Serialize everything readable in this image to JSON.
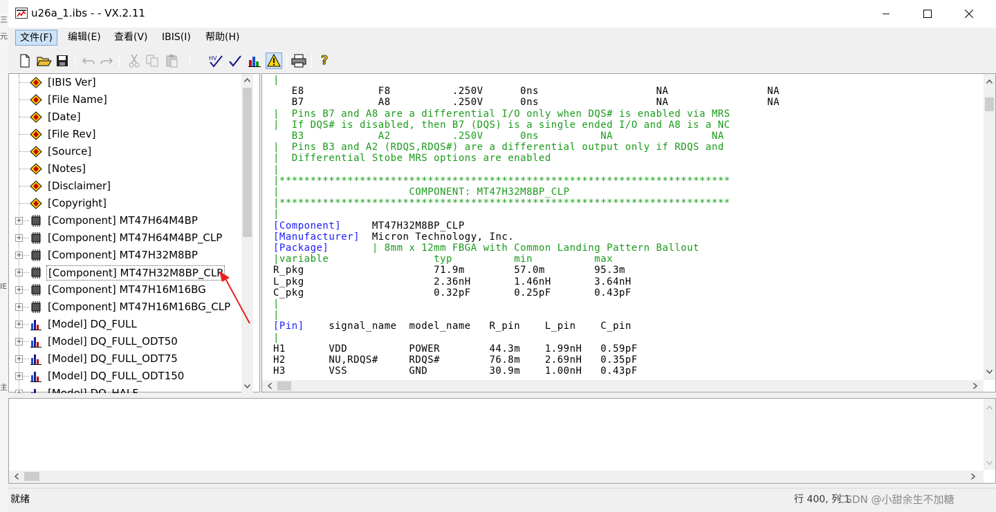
{
  "window": {
    "title": "u26a_1.ibs - - VX.2.11"
  },
  "menu": {
    "file": "文件(F)",
    "edit": "编辑(E)",
    "view": "查看(V)",
    "ibis": "IBIS(I)",
    "help": "帮助(H)"
  },
  "toolbar": {
    "icons": [
      "new-file-icon",
      "open-folder-icon",
      "save-icon",
      "undo-icon",
      "redo-icon",
      "cut-icon",
      "copy-icon",
      "paste-icon",
      "check-syntax-icon",
      "check-icon",
      "chart-icon",
      "warning-icon",
      "print-icon",
      "help-icon"
    ]
  },
  "tree": {
    "items": [
      {
        "label": "[IBIS Ver]",
        "type": "keyword"
      },
      {
        "label": "[File Name]",
        "type": "keyword"
      },
      {
        "label": "[Date]",
        "type": "keyword"
      },
      {
        "label": "[File Rev]",
        "type": "keyword"
      },
      {
        "label": "[Source]",
        "type": "keyword"
      },
      {
        "label": "[Notes]",
        "type": "keyword"
      },
      {
        "label": "[Disclaimer]",
        "type": "keyword"
      },
      {
        "label": "[Copyright]",
        "type": "keyword"
      },
      {
        "label": "[Component] MT47H64M4BP",
        "type": "component"
      },
      {
        "label": "[Component] MT47H64M4BP_CLP",
        "type": "component"
      },
      {
        "label": "[Component] MT47H32M8BP",
        "type": "component"
      },
      {
        "label": "[Component] MT47H32M8BP_CLP",
        "type": "component",
        "selected": true
      },
      {
        "label": "[Component] MT47H16M16BG",
        "type": "component"
      },
      {
        "label": "[Component] MT47H16M16BG_CLP",
        "type": "component"
      },
      {
        "label": "[Model] DQ_FULL",
        "type": "model"
      },
      {
        "label": "[Model] DQ_FULL_ODT50",
        "type": "model"
      },
      {
        "label": "[Model] DQ_FULL_ODT75",
        "type": "model"
      },
      {
        "label": "[Model] DQ_FULL_ODT150",
        "type": "model"
      },
      {
        "label": "[Model] DQ_HALF",
        "type": "model"
      }
    ]
  },
  "code": {
    "lines": [
      {
        "text": "|",
        "color": "green"
      },
      {
        "text": "   E8            F8          .250V      0ns                   NA                NA",
        "color": "black"
      },
      {
        "text": "   B7            A8          .250V      0ns                   NA                NA",
        "color": "black"
      },
      {
        "text": "|  Pins B7 and A8 are a differential I/O only when DQS# is enabled via MRS",
        "color": "green"
      },
      {
        "text": "|  If DQS# is disabled, then B7 (DQS) is a single ended I/O and A8 is a NC",
        "color": "green"
      },
      {
        "text": "   B3            A2          .250V      0ns          NA                NA",
        "color": "green"
      },
      {
        "text": "|  Pins B3 and A2 (RDQS,RDQS#) are a differential output only if RDQS and",
        "color": "green"
      },
      {
        "text": "|  Differential Stobe MRS options are enabled",
        "color": "green"
      },
      {
        "text": "|",
        "color": "green"
      },
      {
        "text": "|*************************************************************************",
        "color": "green"
      },
      {
        "text": "|                     COMPONENT: MT47H32M8BP_CLP",
        "color": "green"
      },
      {
        "text": "|*************************************************************************",
        "color": "green"
      },
      {
        "text": "|",
        "color": "green"
      },
      {
        "text": "[Component]     MT47H32M8BP_CLP",
        "color": "mixed",
        "key": "[Component]",
        "rest": "     MT47H32M8BP_CLP"
      },
      {
        "text": "[Manufacturer]  Micron Technology, Inc.",
        "color": "mixed",
        "key": "[Manufacturer]",
        "rest": "  Micron Technology, Inc."
      },
      {
        "text": "[Package]       | 8mm x 12mm FBGA with Common Landing Pattern Ballout",
        "color": "mixed2",
        "key": "[Package]",
        "rest": "       | 8mm x 12mm FBGA with Common Landing Pattern Ballout"
      },
      {
        "text": "|variable                 typ          min          max",
        "color": "green"
      },
      {
        "text": "R_pkg                     71.9m        57.0m        95.3m",
        "color": "black"
      },
      {
        "text": "L_pkg                     2.36nH       1.46nH       3.64nH",
        "color": "black"
      },
      {
        "text": "C_pkg                     0.32pF       0.25pF       0.43pF",
        "color": "black"
      },
      {
        "text": "|",
        "color": "green"
      },
      {
        "text": "|",
        "color": "green"
      },
      {
        "text": "[Pin]    signal_name  model_name   R_pin    L_pin    C_pin",
        "color": "mixed",
        "key": "[Pin]",
        "rest": "    signal_name  model_name   R_pin    L_pin    C_pin"
      },
      {
        "text": "|",
        "color": "green"
      },
      {
        "text": "H1       VDD          POWER        44.3m    1.99nH   0.59pF",
        "color": "black"
      },
      {
        "text": "H2       NU,RDQS#     RDQS#        76.8m    2.69nH   0.35pF",
        "color": "black"
      },
      {
        "text": "H3       VSS          GND          30.9m    1.00nH   0.43pF",
        "color": "black"
      }
    ]
  },
  "status": {
    "text": "就绪",
    "position": "行 400, 列 1"
  },
  "watermark": "CSDN @小甜余生不加糖",
  "colors": {
    "code_green": "#199a19",
    "code_blue": "#1a1aff",
    "selection_bg": "#cce4f7"
  }
}
